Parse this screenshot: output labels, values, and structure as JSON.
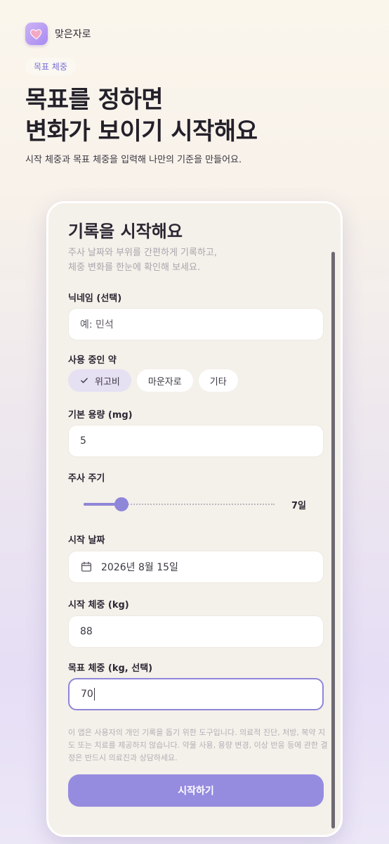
{
  "app": {
    "name": "맞은자로",
    "icon": "heart-icon"
  },
  "hero": {
    "chip": "목표 체중",
    "title_line1": "목표를 정하면",
    "title_line2": "변화가 보이기 시작해요",
    "subtitle": "시작 체중과 목표 체중을 입력해 나만의 기준을 만들어요."
  },
  "form": {
    "title": "기록을 시작해요",
    "desc_line1": "주사 날짜와 부위를 간편하게 기록하고,",
    "desc_line2": "체중 변화를 한눈에 확인해 보세요.",
    "nickname": {
      "label": "닉네임 (선택)",
      "placeholder": "예: 민석"
    },
    "medicine": {
      "label": "사용 중인 약",
      "options": [
        "위고비",
        "마운자로",
        "기타"
      ],
      "selected": "위고비"
    },
    "dose": {
      "label": "기본 용량 (mg)",
      "value": "5"
    },
    "cycle": {
      "label": "주사 주기",
      "value": "7일",
      "level_fraction": 0.2
    },
    "start_date": {
      "label": "시작 날짜",
      "value": "2026년 8월 15일",
      "icon": "calendar-icon"
    },
    "start_weight": {
      "label": "시작 체중 (kg)",
      "value": "88"
    },
    "goal_weight": {
      "label": "목표 체중 (kg, 선택)",
      "value": "70"
    },
    "disclaimer": "이 앱은 사용자의 개인 기록을 돕기 위한 도구입니다. 의료적 진단, 처방, 복약 지도 또는 치료를 제공하지 않습니다. 약물 사용, 용량 변경, 이상 반응 등에 관한 결정은 반드시 의료진과 상담하세요.",
    "submit_label": "시작하기"
  },
  "colors": {
    "accent": "#8e86d8",
    "button": "#958ce0",
    "chip_text": "#7c6fd6",
    "selected_pill": "#e6e0f3"
  }
}
